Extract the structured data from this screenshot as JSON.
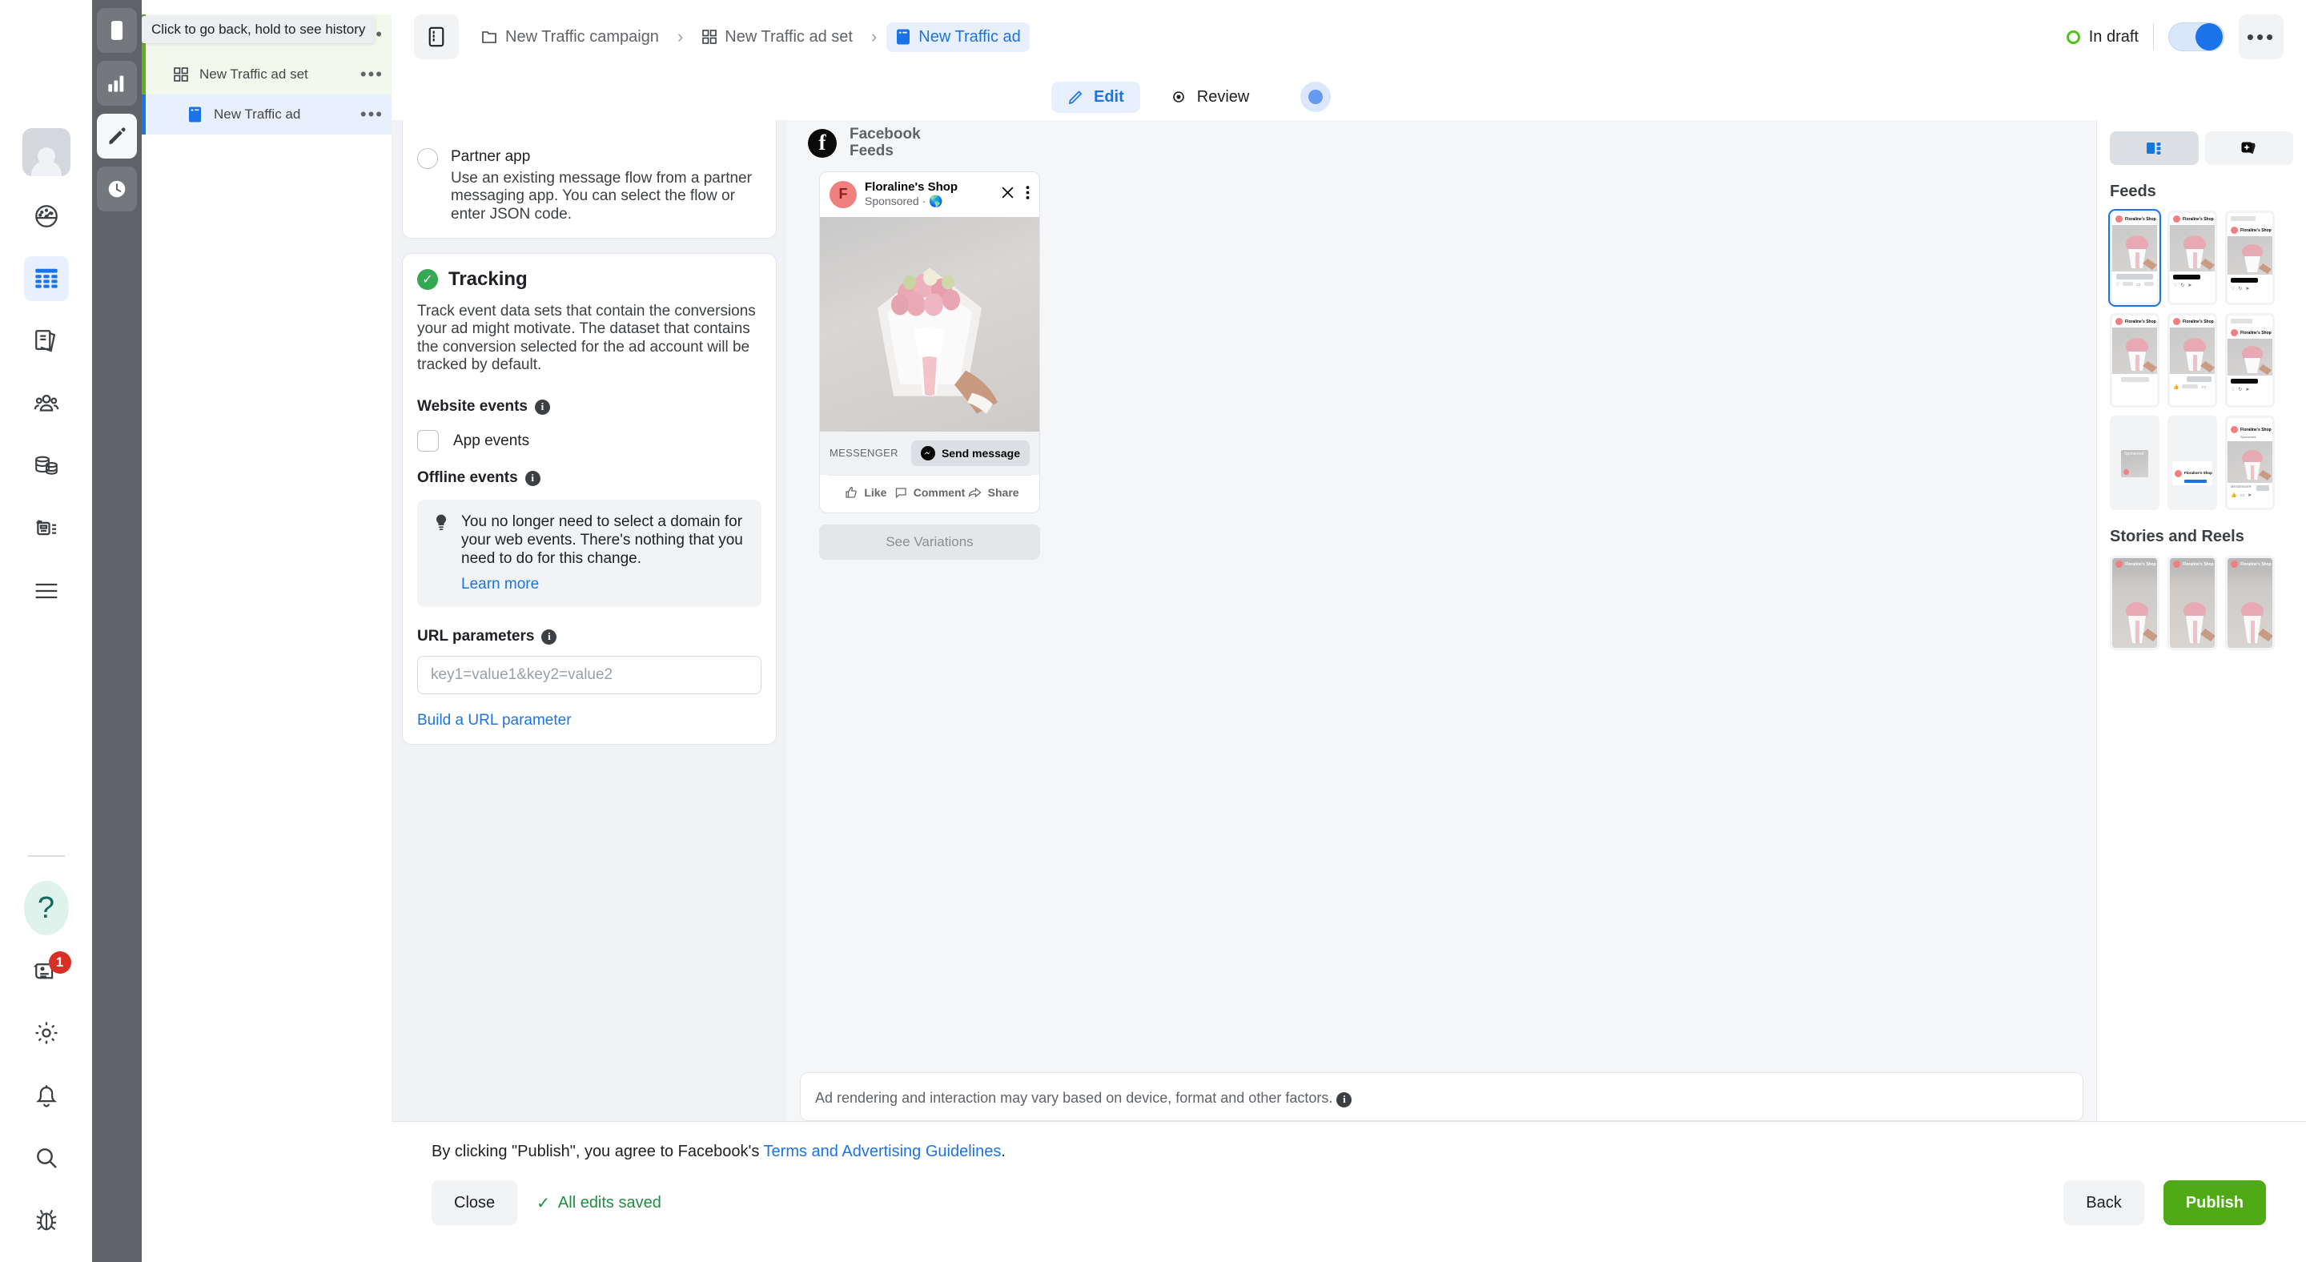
{
  "tooltip": {
    "text": "Click to go back, hold to see history"
  },
  "rail": {
    "icons": [
      {
        "name": "avatar",
        "label": "Account avatar"
      },
      {
        "name": "speedometer-icon",
        "label": "Performance"
      },
      {
        "name": "table-icon",
        "label": "Campaigns table"
      },
      {
        "name": "library-icon",
        "label": "Creative library"
      },
      {
        "name": "audience-icon",
        "label": "Audiences"
      },
      {
        "name": "datasets-icon",
        "label": "Datasets"
      },
      {
        "name": "catalog-icon",
        "label": "Catalog"
      },
      {
        "name": "menu-icon",
        "label": "All tools"
      }
    ],
    "bottom": [
      {
        "name": "help-icon",
        "label": "Help",
        "glyph": "?"
      },
      {
        "name": "news-icon",
        "label": "News",
        "badge": "1"
      },
      {
        "name": "gear-icon",
        "label": "Settings"
      },
      {
        "name": "bell-icon",
        "label": "Notifications"
      },
      {
        "name": "search-icon",
        "label": "Search"
      },
      {
        "name": "bug-icon",
        "label": "Report a bug"
      }
    ]
  },
  "darkbar": {
    "buttons": [
      {
        "name": "back-button",
        "label": "Back"
      },
      {
        "name": "chart-button",
        "label": "Charts"
      },
      {
        "name": "edit-button",
        "label": "Edit"
      },
      {
        "name": "history-button",
        "label": "History"
      }
    ]
  },
  "tree": {
    "items": [
      {
        "label": "New Traffic campaign",
        "icon": "campaign-icon",
        "state": "campaign",
        "indent": 1
      },
      {
        "label": "New Traffic ad set",
        "icon": "adset-icon",
        "state": "adset",
        "indent": 2
      },
      {
        "label": "New Traffic ad",
        "icon": "ad-icon",
        "state": "ad",
        "indent": 3
      }
    ],
    "more_glyph": "•••"
  },
  "topbar": {
    "panel_toggle_name": "panel-toggle-icon",
    "breadcrumbs": [
      {
        "label": "New Traffic campaign",
        "icon": "folder-icon",
        "active": false
      },
      {
        "label": "New Traffic ad set",
        "icon": "grid-icon",
        "active": false
      },
      {
        "label": "New Traffic ad",
        "icon": "ad-icon",
        "active": true
      }
    ],
    "separator": "›",
    "status_label": "In draft",
    "status_color": "#4fc413",
    "toggle_on": true,
    "more_glyph": "•••"
  },
  "tabs": [
    {
      "label": "Edit",
      "icon": "pencil-icon",
      "active": true
    },
    {
      "label": "Review",
      "icon": "eye-icon",
      "active": false
    }
  ],
  "form": {
    "partner_app": {
      "title": "Partner app",
      "description": "Use an existing message flow from a partner messaging app. You can select the flow or enter JSON code.",
      "selected": false
    },
    "tracking": {
      "title": "Tracking",
      "description": "Track event data sets that contain the conversions your ad might motivate. The dataset that contains the conversion selected for the ad account will be tracked by default.",
      "website_events_label": "Website events",
      "app_events_label": "App events",
      "app_events_checked": false,
      "offline_events_label": "Offline events",
      "notice_text": "You no longer need to select a domain for your web events. There's nothing that you need to do for this change.",
      "notice_link": "Learn more",
      "url_params_label": "URL parameters",
      "url_params_value": "",
      "url_params_placeholder": "key1=value1&key2=value2",
      "build_link": "Build a URL parameter"
    }
  },
  "preview": {
    "platform_line1": "Facebook",
    "platform_line2": "Feeds",
    "page_name": "Floraline's Shop",
    "sponsored": "Sponsored",
    "globe_glyph": "🌎",
    "avatar_letter": "F",
    "cta_label": "MESSENGER",
    "cta_button": "Send message",
    "social": [
      {
        "label": "Like",
        "icon": "thumbs-up-icon"
      },
      {
        "label": "Comment",
        "icon": "comment-icon"
      },
      {
        "label": "Share",
        "icon": "share-icon"
      }
    ],
    "see_variations": "See Variations",
    "render_note": "Ad rendering and interaction may vary based on device, format and other factors."
  },
  "placements": {
    "segments": [
      {
        "name": "placement-view-button",
        "active": true
      },
      {
        "name": "ai-variations-button",
        "active": false
      }
    ],
    "groups": [
      {
        "title": "Feeds",
        "count": 9
      },
      {
        "title": "Stories and Reels",
        "count": 3
      }
    ],
    "thumb_name": "Floraline's Shop"
  },
  "footer": {
    "terms_prefix": "By clicking \"Publish\", you agree to Facebook's ",
    "terms_link": "Terms and Advertising Guidelines",
    "terms_suffix": ".",
    "close_label": "Close",
    "saved_label": "All edits saved",
    "saved_check": "✓",
    "back_label": "Back",
    "publish_label": "Publish"
  },
  "colors": {
    "brand_blue": "#1a73e8",
    "publish_green": "#4faa16",
    "status_green": "#4fc413",
    "saved_green": "#1e8e3e",
    "badge_red": "#d93025"
  }
}
